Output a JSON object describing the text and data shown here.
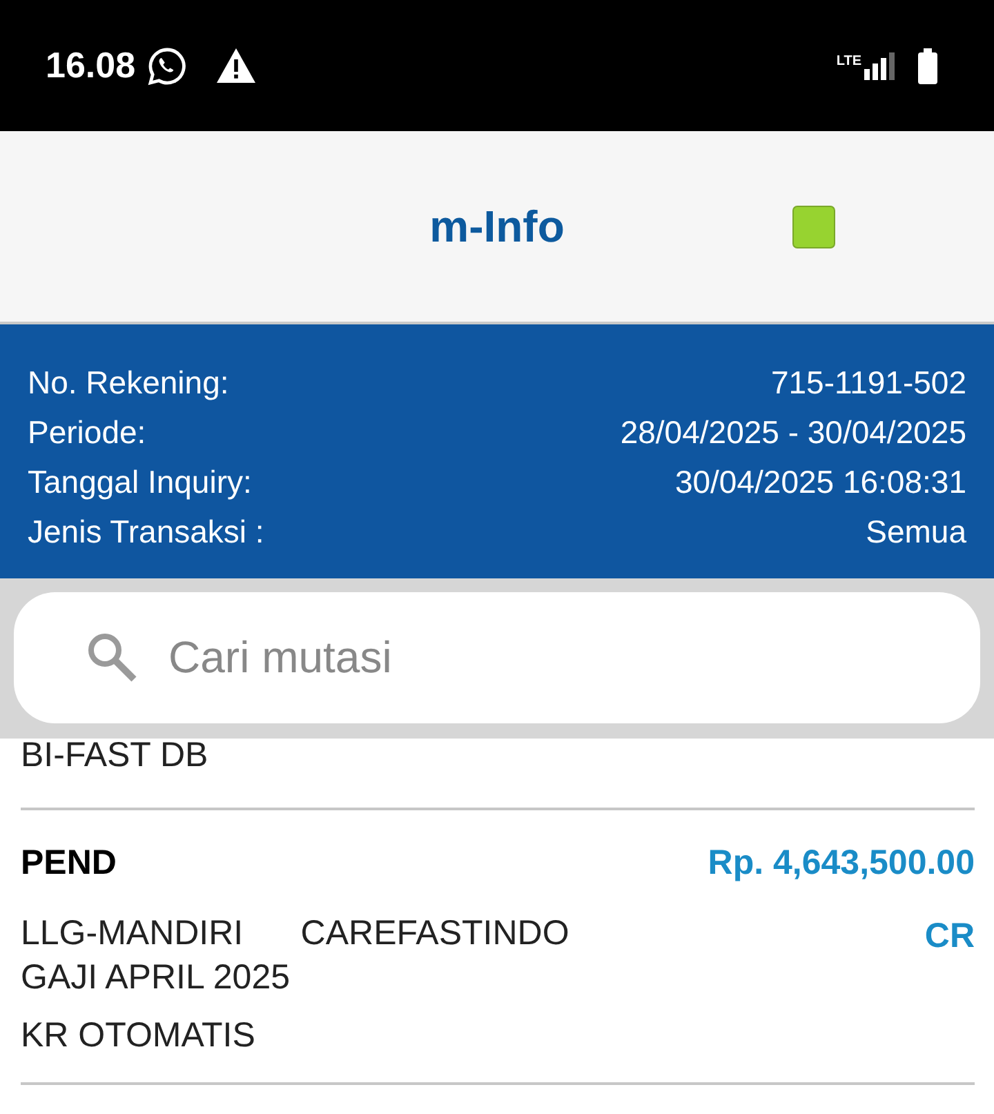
{
  "status_bar": {
    "time": "16.08",
    "network": "LTE"
  },
  "header": {
    "title": "m-Info"
  },
  "account_info": [
    {
      "label": "No. Rekening:",
      "value": "715-1191-502"
    },
    {
      "label": "Periode:",
      "value": "28/04/2025 - 30/04/2025"
    },
    {
      "label": "Tanggal Inquiry:",
      "value": "30/04/2025 16:08:31"
    },
    {
      "label": "Jenis Transaksi :",
      "value": "Semua"
    }
  ],
  "search": {
    "placeholder": "Cari mutasi"
  },
  "transactions": [
    {
      "kind": "partial",
      "lines": [
        "BI-FAST DB"
      ]
    },
    {
      "kind": "full",
      "date": "PEND",
      "amount": "Rp. 4,643,500.00",
      "type": "CR",
      "lines": [
        "LLG-MANDIRI      CAREFASTINDO",
        "GAJI APRIL 2025"
      ],
      "note": "KR OTOMATIS"
    }
  ]
}
